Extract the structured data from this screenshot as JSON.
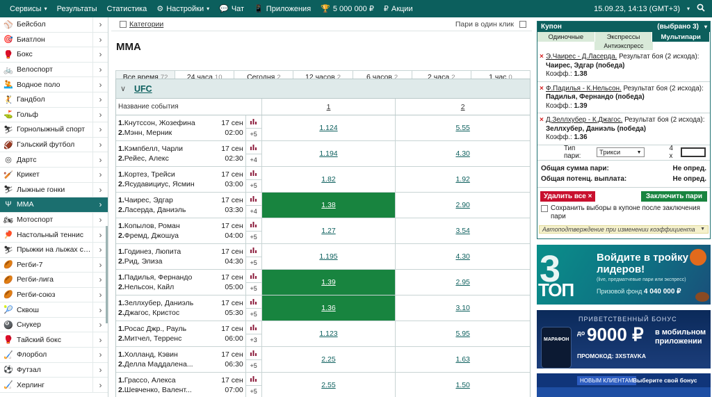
{
  "topbar": {
    "menu": [
      {
        "label": "Сервисы",
        "icon": "",
        "caret": true
      },
      {
        "label": "Результаты",
        "icon": "",
        "caret": false
      },
      {
        "label": "Статистика",
        "icon": "",
        "caret": false
      },
      {
        "label": "Настройки",
        "icon": "⚙",
        "caret": true
      },
      {
        "label": "Чат",
        "icon": "💬",
        "caret": false
      },
      {
        "label": "Приложения",
        "icon": "📱",
        "caret": false
      },
      {
        "label": "5 000 000 ₽",
        "icon": "🏆",
        "caret": false
      },
      {
        "label": "Акции",
        "icon": "₽",
        "caret": false
      }
    ],
    "datetime": "15.09.23, 14:13 (GMT+3)",
    "search_icon": "search-icon"
  },
  "sidebar": {
    "items": [
      {
        "label": "Бейсбол",
        "icon": "baseball-icon",
        "glyph": "⚾"
      },
      {
        "label": "Биатлон",
        "icon": "biathlon-icon",
        "glyph": "🎯"
      },
      {
        "label": "Бокс",
        "icon": "boxing-icon",
        "glyph": "🥊"
      },
      {
        "label": "Велоспорт",
        "icon": "cycling-icon",
        "glyph": "🚲"
      },
      {
        "label": "Водное поло",
        "icon": "water-polo-icon",
        "glyph": "🤽"
      },
      {
        "label": "Гандбол",
        "icon": "handball-icon",
        "glyph": "🤾"
      },
      {
        "label": "Гольф",
        "icon": "golf-icon",
        "glyph": "⛳"
      },
      {
        "label": "Горнолыжный спорт",
        "icon": "ski-icon",
        "glyph": "⛷"
      },
      {
        "label": "Гэльский футбол",
        "icon": "gaelic-football-icon",
        "glyph": "🏈"
      },
      {
        "label": "Дартс",
        "icon": "darts-icon",
        "glyph": "◎"
      },
      {
        "label": "Крикет",
        "icon": "cricket-icon",
        "glyph": "🏏"
      },
      {
        "label": "Лыжные гонки",
        "icon": "cross-country-ski-icon",
        "glyph": "⛷"
      },
      {
        "label": "ММА",
        "icon": "mma-icon",
        "glyph": "Ψ",
        "active": true
      },
      {
        "label": "Мотоспорт",
        "icon": "motorsport-icon",
        "glyph": "🏍"
      },
      {
        "label": "Настольный теннис",
        "icon": "table-tennis-icon",
        "glyph": "🏓"
      },
      {
        "label": "Прыжки на лыжах с т...",
        "icon": "ski-jumping-icon",
        "glyph": "⛷"
      },
      {
        "label": "Регби-7",
        "icon": "rugby7-icon",
        "glyph": "🏉"
      },
      {
        "label": "Регби-лига",
        "icon": "rugby-league-icon",
        "glyph": "🏉"
      },
      {
        "label": "Регби-союз",
        "icon": "rugby-union-icon",
        "glyph": "🏉"
      },
      {
        "label": "Сквош",
        "icon": "squash-icon",
        "glyph": "🎾"
      },
      {
        "label": "Снукер",
        "icon": "snooker-icon",
        "glyph": "🎱"
      },
      {
        "label": "Тайский бокс",
        "icon": "thai-boxing-icon",
        "glyph": "🥊"
      },
      {
        "label": "Флорбол",
        "icon": "floorball-icon",
        "glyph": "🏑"
      },
      {
        "label": "Футзал",
        "icon": "futsal-icon",
        "glyph": "⚽"
      },
      {
        "label": "Херлинг",
        "icon": "hurling-icon",
        "glyph": "🏑"
      }
    ]
  },
  "main": {
    "categories_label": "Категории",
    "one_click_label": "Пари в один клик",
    "title": "ММА",
    "time_tabs": [
      {
        "label": "Все время",
        "count": "72",
        "active": true
      },
      {
        "label": "24 часа",
        "count": "10"
      },
      {
        "label": "Сегодня",
        "count": "2"
      },
      {
        "label": "12 часов",
        "count": "2"
      },
      {
        "label": "6 часов",
        "count": "2"
      },
      {
        "label": "2 часа",
        "count": "2"
      },
      {
        "label": "1 час",
        "count": "0"
      }
    ],
    "league": "UFC",
    "headers": {
      "name": "Название события",
      "col1": "1",
      "col2": "2"
    },
    "events": [
      {
        "p1": "Кнутссон, Жозефина",
        "p2": "Мэнн, Мерник",
        "date": "17 сен",
        "time": "02:00",
        "more": "+5",
        "o1": "1.124",
        "o2": "5.55",
        "sel": ""
      },
      {
        "p1": "Кэмпбелл, Чарли",
        "p2": "Рейес, Алекс",
        "date": "17 сен",
        "time": "02:30",
        "more": "+4",
        "o1": "1.194",
        "o2": "4.30",
        "sel": ""
      },
      {
        "p1": "Кортез, Трейси",
        "p2": "Ясудавициус, Ясмин",
        "date": "17 сен",
        "time": "03:00",
        "more": "+5",
        "o1": "1.82",
        "o2": "1.92",
        "sel": ""
      },
      {
        "p1": "Чаирес, Эдгар",
        "p2": "Ласерда, Даниэль",
        "date": "17 сен",
        "time": "03:30",
        "more": "+4",
        "o1": "1.38",
        "o2": "2.90",
        "sel": "1"
      },
      {
        "p1": "Копылов, Роман",
        "p2": "Фремд, Джошуа",
        "date": "17 сен",
        "time": "04:00",
        "more": "+5",
        "o1": "1.27",
        "o2": "3.54",
        "sel": ""
      },
      {
        "p1": "Годинез, Люпита",
        "p2": "Рид, Элиза",
        "date": "17 сен",
        "time": "04:30",
        "more": "+5",
        "o1": "1.195",
        "o2": "4.30",
        "sel": ""
      },
      {
        "p1": "Падилья, Фернандо",
        "p2": "Нельсон, Кайл",
        "date": "17 сен",
        "time": "05:00",
        "more": "+5",
        "o1": "1.39",
        "o2": "2.95",
        "sel": "1"
      },
      {
        "p1": "Зеллхубер, Даниэль",
        "p2": "Джагос, Кристос",
        "date": "17 сен",
        "time": "05:30",
        "more": "+5",
        "o1": "1.36",
        "o2": "3.10",
        "sel": "1"
      },
      {
        "p1": "Росас Джр., Рауль",
        "p2": "Митчел, Терренс",
        "date": "17 сен",
        "time": "06:00",
        "more": "+3",
        "o1": "1.123",
        "o2": "5.95",
        "sel": ""
      },
      {
        "p1": "Холланд, Кэвин",
        "p2": "Делла Маддалена...",
        "date": "17 сен",
        "time": "06:30",
        "more": "+5",
        "o1": "2.25",
        "o2": "1.63",
        "sel": ""
      },
      {
        "p1": "Грассо, Алекса",
        "p2": "Шевченко, Валент...",
        "date": "17 сен",
        "time": "07:00",
        "more": "+5",
        "o1": "2.55",
        "o2": "1.50",
        "sel": ""
      }
    ]
  },
  "coupon": {
    "title": "Купон",
    "selected": "(выбрано 3)",
    "tabs": [
      {
        "label": "Одиночные"
      },
      {
        "label": "Экспрессы"
      },
      {
        "label": "Мультипари",
        "active": true
      }
    ],
    "antiexpress": "Антиэкспресс",
    "picks": [
      {
        "event": "Э.Чаирес - Д.Ласерда.",
        "market": "Результат боя (2 исхода):",
        "selection": "Чаирес, Эдгар (победа)",
        "coef_label": "Коэфф.:",
        "coef": "1.38"
      },
      {
        "event": "Ф.Падилья - К.Нельсон.",
        "market": "Результат боя (2 исхода):",
        "selection": "Падилья, Фернандо (победа)",
        "coef_label": "Коэфф.:",
        "coef": "1.39"
      },
      {
        "event": "Д.Зеллхубер - К.Джагос.",
        "market": "Результат боя (2 исхода):",
        "selection": "Зеллхубер, Даниэль (победа)",
        "coef_label": "Коэфф.:",
        "coef": "1.36"
      }
    ],
    "bet_type_label": "Тип пари:",
    "bet_type_value": "Трикси",
    "multiplier": "4 x",
    "total_label": "Общая сумма пари:",
    "total_value": "Не опред.",
    "payout_label": "Общая потенц. выплата:",
    "payout_value": "Не опред.",
    "delete_all": "Удалить все",
    "place_bet": "Заключить пари",
    "keep_label": "Сохранить выборы в купоне после заключения пари",
    "auto_confirm": "Автоподтверждение при изменении коэффициента"
  },
  "banners": {
    "b1": {
      "big": "3",
      "top": "ТОП",
      "headline1": "Войдите в тройку",
      "headline2": "лидеров!",
      "sub": "(live, предматчевые пари или экспресс)",
      "prize_label": "Призовой фонд",
      "prize_value": "4 040 000 ₽"
    },
    "b2": {
      "title": "ПРИВЕТСТВЕННЫЙ БОНУС",
      "prefix": "до",
      "amount": "9000 ₽",
      "mobile1": "в мобильном",
      "mobile2": "приложении",
      "promo": "ПРОМОКОД: 3XSTAVKA",
      "logo": "МАРАФОН"
    },
    "b3": {
      "pill": "НОВЫМ КЛИЕНТАМ",
      "choose": "Выберите свой бонус"
    }
  }
}
